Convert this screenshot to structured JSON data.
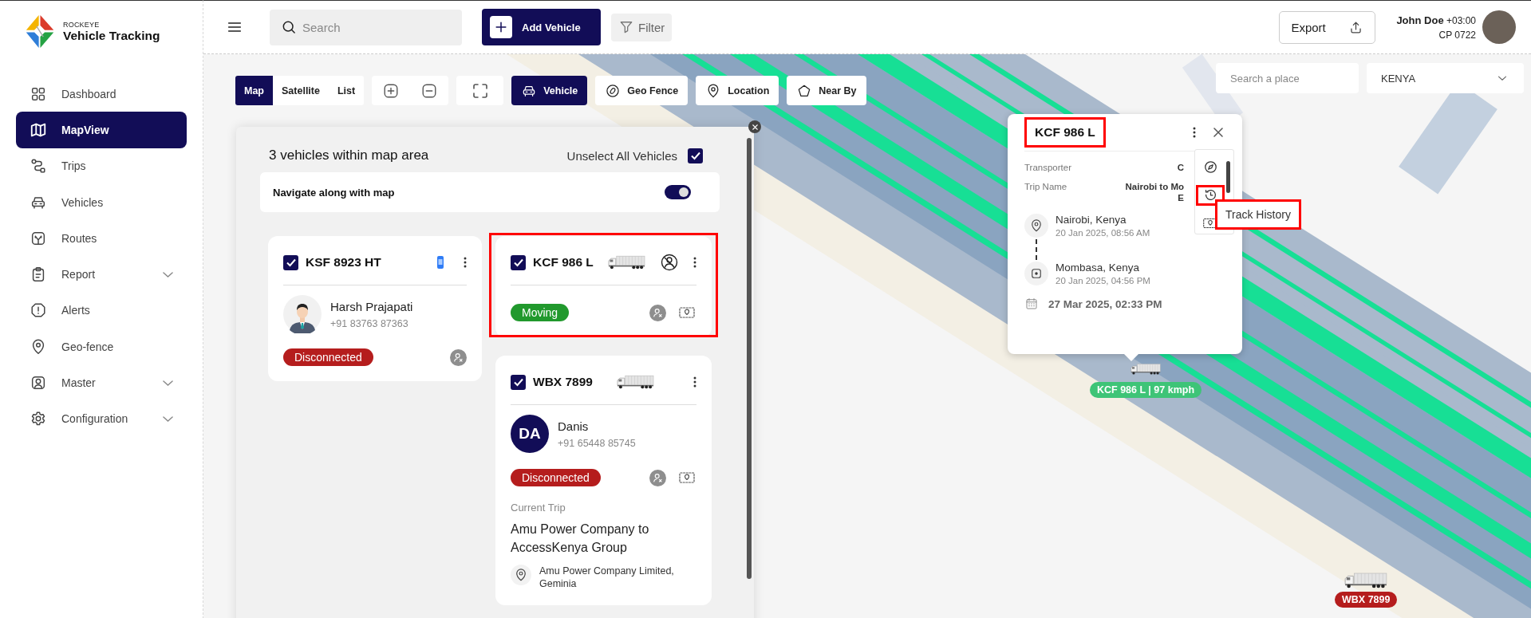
{
  "brand": {
    "company": "ROCKEYE",
    "product": "Vehicle Tracking"
  },
  "sidebar": {
    "items": [
      {
        "label": "Dashboard",
        "selected": false,
        "expandable": false
      },
      {
        "label": "MapView",
        "selected": true,
        "expandable": false
      },
      {
        "label": "Trips",
        "selected": false,
        "expandable": false
      },
      {
        "label": "Vehicles",
        "selected": false,
        "expandable": false
      },
      {
        "label": "Routes",
        "selected": false,
        "expandable": false
      },
      {
        "label": "Report",
        "selected": false,
        "expandable": true
      },
      {
        "label": "Alerts",
        "selected": false,
        "expandable": false
      },
      {
        "label": "Geo-fence",
        "selected": false,
        "expandable": false
      },
      {
        "label": "Master",
        "selected": false,
        "expandable": true
      },
      {
        "label": "Configuration",
        "selected": false,
        "expandable": true
      }
    ]
  },
  "header": {
    "search": {
      "placeholder": "Search"
    },
    "add_button": "Add Vehicle",
    "filter_button": "Filter",
    "export_button": "Export",
    "user": {
      "name": "John Doe",
      "timezone": "+03:00",
      "code": "CP 0722"
    }
  },
  "map_toolbar": {
    "view_tabs": [
      {
        "label": "Map",
        "selected": true
      },
      {
        "label": "Satellite",
        "selected": false
      },
      {
        "label": "List",
        "selected": false
      }
    ],
    "layers": [
      {
        "label": "Vehicle",
        "selected": true
      },
      {
        "label": "Geo Fence",
        "selected": false
      },
      {
        "label": "Location",
        "selected": false
      },
      {
        "label": "Near By",
        "selected": false
      }
    ],
    "place_search": {
      "placeholder": "Search a place"
    },
    "country_select": {
      "value": "KENYA"
    }
  },
  "vehicle_panel": {
    "title": "3 vehicles within map area",
    "unselect_all": {
      "label": "Unselect All Vehicles",
      "checked": true
    },
    "navigate": {
      "label": "Navigate along with map",
      "on": true
    },
    "vehicles": [
      {
        "plate": "KSF 8923 HT",
        "checked": true,
        "driver_missing": false,
        "highlighted": false,
        "driver": {
          "name": "Harsh Prajapati",
          "phone": "+91 83763 87363"
        },
        "status": {
          "label": "Disconnected",
          "color": "#b51d1d"
        },
        "route_button": false
      },
      {
        "plate": "KCF 986 L",
        "checked": true,
        "driver_missing": true,
        "highlighted": true,
        "status": {
          "label": "Moving",
          "color": "#21992d"
        },
        "route_button": true
      },
      {
        "plate": "WBX 7899",
        "checked": true,
        "driver_missing": false,
        "highlighted": false,
        "driver": {
          "name": "Danis",
          "phone": "+91 65448 85745",
          "initials": "DA"
        },
        "status": {
          "label": "Disconnected",
          "color": "#b51d1d"
        },
        "route_button": true,
        "current_trip": {
          "label": "Current Trip",
          "name": "Amu Power Company to AccessKenya Group",
          "origin": "Amu Power Company Limited, Geminia"
        }
      }
    ]
  },
  "popup": {
    "title": "KCF 986 L",
    "title_highlighted": true,
    "fields": [
      {
        "label": "Transporter",
        "value": "C"
      },
      {
        "label": "Trip Name",
        "value": "Nairobi to Mo",
        "value_continued": "E"
      }
    ],
    "stops": [
      {
        "place": "Nairobi, Kenya",
        "time": "20 Jan 2025, 08:56 AM",
        "kind": "origin"
      },
      {
        "place": "Mombasa, Kenya",
        "time": "20 Jan 2025, 04:56 PM",
        "kind": "destination"
      }
    ],
    "date": "27 Mar 2025, 02:33 PM",
    "tools": [
      {
        "highlighted": false
      },
      {
        "highlighted": true
      },
      {
        "highlighted": false
      }
    ],
    "tooltip": {
      "text": "Track History",
      "highlighted": true
    }
  },
  "map_markers": [
    {
      "label": "KCF 986 L | 97 kmph",
      "color": "#3ec477"
    },
    {
      "label": "WBX 7899",
      "color": "#b51d1d"
    }
  ]
}
